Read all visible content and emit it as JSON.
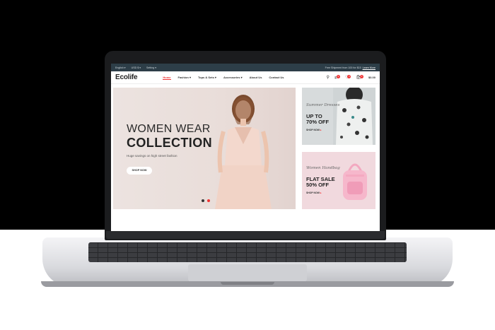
{
  "topbar": {
    "language": "English",
    "currency": "USD $",
    "setting": "Setting",
    "shipping_text": "Free Shipment from 100 for $15",
    "learn_more": "Learn More"
  },
  "header": {
    "logo": "Ecolife",
    "nav": [
      "Home",
      "Fashion",
      "Tops & Sets",
      "Accessories",
      "About Us",
      "Contact Us"
    ],
    "compare_count": "0",
    "wishlist_count": "0",
    "cart_count": "0",
    "cart_total": "$0.00"
  },
  "hero": {
    "title_line1": "WOMEN WEAR",
    "title_line2": "COLLECTION",
    "subtitle": "Huge savings on high street fashion",
    "button": "SHOP NOW"
  },
  "promos": [
    {
      "script": "Summer Dresses",
      "big_line1": "UP TO",
      "big_line2": "70% OFF",
      "button": "SHOP NOW"
    },
    {
      "script": "Women Handbag",
      "big_line1": "FLAT SALE",
      "big_line2": "50% OFF",
      "button": "SHOP NOW"
    }
  ],
  "colors": {
    "accent": "#ee3333",
    "topbar": "#2d3e48",
    "hero_bg": "#ece3e0"
  },
  "icons": [
    "search-icon",
    "compare-icon",
    "heart-icon",
    "cart-icon",
    "chevron-down-icon"
  ]
}
